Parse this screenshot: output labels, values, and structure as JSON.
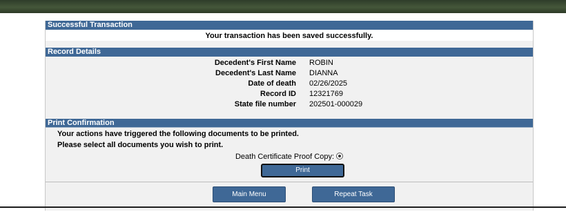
{
  "success": {
    "header": "Successful Transaction",
    "message": "Your transaction has been saved successfully."
  },
  "record": {
    "header": "Record Details",
    "fields": [
      {
        "label": "Decedent's First Name",
        "value": "ROBIN"
      },
      {
        "label": "Decedent's Last Name",
        "value": "DIANNA"
      },
      {
        "label": "Date of death",
        "value": "02/26/2025"
      },
      {
        "label": "Record ID",
        "value": "12321769"
      },
      {
        "label": "State file number",
        "value": "202501-000029"
      }
    ]
  },
  "print": {
    "header": "Print Confirmation",
    "note1": "Your actions have triggered the following documents to be printed.",
    "note2": "Please select all documents you wish to print.",
    "document_label": "Death Certificate Proof Copy:",
    "button_label": "Print"
  },
  "footer": {
    "main_menu_label": "Main Menu",
    "repeat_task_label": "Repeat Task"
  },
  "colors": {
    "header_blue": "#3f6896",
    "top_bar": "#3a4a31"
  }
}
